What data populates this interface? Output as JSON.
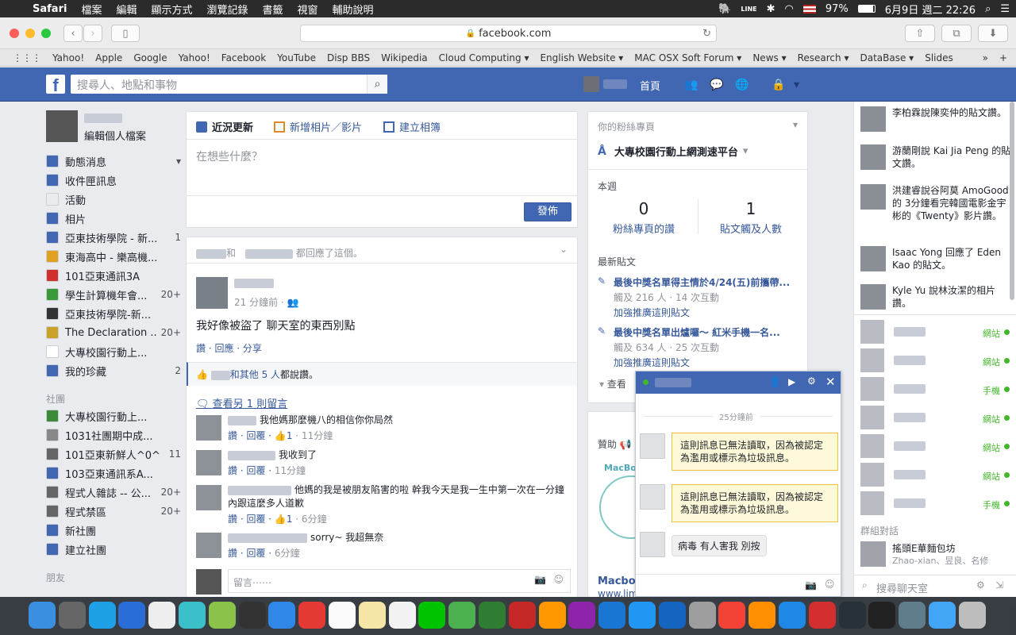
{
  "menubar": {
    "app": "Safari",
    "items": [
      "檔案",
      "編輯",
      "顯示方式",
      "瀏覽記錄",
      "書籤",
      "視窗",
      "輔助說明"
    ],
    "battery": "97%",
    "datetime": "6月9日 週二 22:26",
    "input_method": "LINE"
  },
  "browser": {
    "url": "facebook.com",
    "bookmarks": [
      "Yahoo!",
      "Apple",
      "Google",
      "Yahoo!",
      "Facebook",
      "YouTube",
      "Disp BBS",
      "Wikipedia",
      "Cloud Computing ▾",
      "English Website ▾",
      "MAC OSX Soft Forum ▾",
      "News ▾",
      "Research ▾",
      "DataBase ▾",
      "Slides"
    ],
    "overflow": "»"
  },
  "header": {
    "logo": "f",
    "search_placeholder": "搜尋人、地點和事物",
    "home": "首頁"
  },
  "profile": {
    "edit": "編輯個人檔案"
  },
  "leftnav": {
    "items": [
      {
        "label": "動態消息",
        "count": "▾",
        "color": "#4267b2"
      },
      {
        "label": "收件匣訊息",
        "count": "",
        "color": "#4267b2"
      },
      {
        "label": "活動",
        "count": "",
        "color": "#e9ebee"
      },
      {
        "label": "相片",
        "count": "",
        "color": "#4267b2"
      },
      {
        "label": "亞東技術學院 - 新...",
        "count": "1",
        "color": "#4267b2"
      },
      {
        "label": "東海高中 - 樂高機...",
        "count": "",
        "color": "#e0a020"
      },
      {
        "label": "101亞東通訊3A",
        "count": "",
        "color": "#d0312d"
      },
      {
        "label": "學生計算機年會...",
        "count": "20+",
        "color": "#3a9a3a"
      },
      {
        "label": "亞東技術學院-新...",
        "count": "",
        "color": "#333"
      },
      {
        "label": "The Declaration ...",
        "count": "20+",
        "color": "#c9a227"
      },
      {
        "label": "大專校園行動上...",
        "count": "",
        "color": "#fff"
      },
      {
        "label": "我的珍藏",
        "count": "2",
        "color": "#4267b2"
      }
    ],
    "groups_title": "社團",
    "groups": [
      {
        "label": "大專校園行動上...",
        "count": "",
        "color": "#3a8a3a"
      },
      {
        "label": "1031社團期中成...",
        "count": "",
        "color": "#888"
      },
      {
        "label": "101亞東新鮮人^0^",
        "count": "11",
        "color": "#666"
      },
      {
        "label": "103亞東通訊系A...",
        "count": "",
        "color": "#4267b2"
      },
      {
        "label": "程式人雜誌 -- 公...",
        "count": "20+",
        "color": "#666"
      },
      {
        "label": "程式禁區",
        "count": "20+",
        "color": "#666"
      },
      {
        "label": "新社團",
        "count": "",
        "color": "#4267b2"
      },
      {
        "label": "建立社團",
        "count": "",
        "color": "#4267b2"
      }
    ],
    "friends_title": "朋友"
  },
  "composer": {
    "tabs": [
      "近況更新",
      "新增相片／影片",
      "建立相簿"
    ],
    "placeholder": "在想些什麼？",
    "post_button": "發佈"
  },
  "post": {
    "story_prefix": "和",
    "story_suffix": "都回應了這個。",
    "time": "21 分鐘前 · ",
    "text": "我好像被盜了 聊天室的東西別點",
    "actions": "讚 · 回應 · 分享",
    "likes_mid": "和其他 5 人",
    "likes_suffix": "都說讚。",
    "more_comments": "查看另 1 則留言",
    "comments": [
      {
        "text": "我他媽那麼機八的相信你你局然",
        "meta": "讚 · 回覆 · ",
        "likes": "1",
        "time": " · 11分鐘"
      },
      {
        "text": "我收到了",
        "meta": "讚 · 回覆 · ",
        "likes": "",
        "time": "11分鐘"
      },
      {
        "text": "他媽的我是被朋友陷害的啦 幹我今天是我一生中第一次在一分鐘內跟這麼多人道歉",
        "meta": "讚 · 回覆 · ",
        "likes": "1",
        "time": " · 6分鐘"
      },
      {
        "text": "sorry~ 我超無奈",
        "meta": "讚 · 回覆 · ",
        "likes": "",
        "time": "6分鐘"
      }
    ],
    "comment_placeholder": "留言⋯⋯"
  },
  "pages": {
    "title": "你的粉絲專頁",
    "page_name": "大專校園行動上網測速平台",
    "week": "本週",
    "likes_count": "0",
    "likes_label": "粉絲專頁的讚",
    "reach_count": "1",
    "reach_label": "貼文觸及人數",
    "recent": "最新貼文",
    "posts": [
      {
        "title": "最後中獎名單得主情於4/24(五)前攜帶...",
        "stats": "觸及 216 人 · 14 次互動",
        "boost": "加強推廣這則貼文"
      },
      {
        "title": "最後中獎名單出爐囉～ 紅米手機一名...",
        "stats": "觸及 634 人 · 25 次互動",
        "boost": "加強推廣這則貼文"
      }
    ],
    "see_more": "查看",
    "sponsored": "贊助",
    "ad_label": "MacBoo",
    "ad_title": "Macboo",
    "ad_url": "www.lim"
  },
  "chat": {
    "time": "25分鐘前",
    "blocked_msg": "這則訊息已無法讀取，因為被認定為濫用或標示為垃圾訊息。",
    "last_msg": "病毒 有人害我 別按"
  },
  "ticker": [
    {
      "text": "李柏霖說陳奕仲的貼文讚。"
    },
    {
      "text": "游蘭剛說 Kai Jia Peng 的貼文讚。"
    },
    {
      "text": "洪建睿說谷阿莫 AmoGood 的 3分鐘看完韓國電影金宇彬的《Twenty》影片讚。"
    },
    {
      "text": "Isaac Yong 回應了 Eden Kao 的貼文。"
    },
    {
      "text": "Kyle Yu 說林汝潔的相片讚。"
    }
  ],
  "online": [
    {
      "status": "網站"
    },
    {
      "status": "網站"
    },
    {
      "status": "手機"
    },
    {
      "status": "網站"
    },
    {
      "status": "網站"
    },
    {
      "status": "網站"
    },
    {
      "status": "手機"
    }
  ],
  "group_chat": {
    "title": "群組對話",
    "name": "搖頭E華麵包坊",
    "members": "Zhao-xian、昱良、名修"
  },
  "chat_search": "搜尋聊天室"
}
